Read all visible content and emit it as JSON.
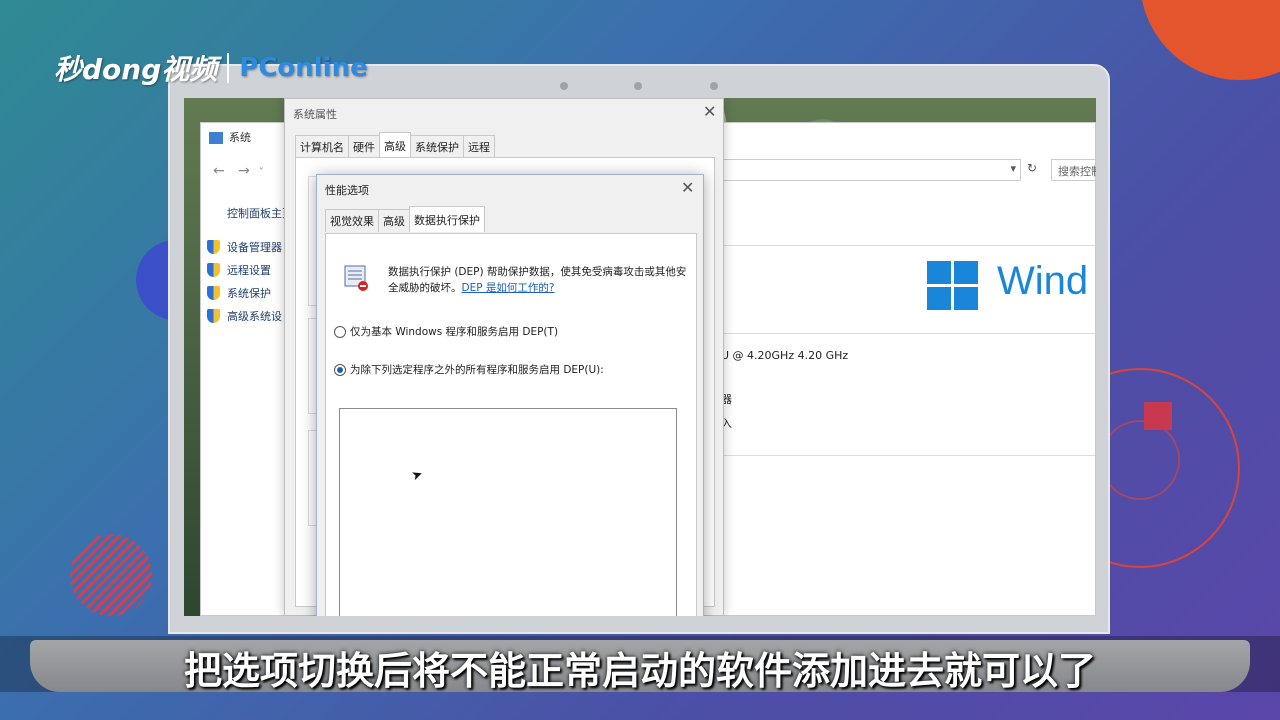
{
  "brand": {
    "name": "秒dong视频",
    "partner": "PConline"
  },
  "subtitle": "把选项切换后将不能正常启动的软件添加进去就可以了",
  "system_window": {
    "title": "系统",
    "search_placeholder": "搜索控制面",
    "side_home": "控制面板主页",
    "side_items": [
      "设备管理器",
      "远程设置",
      "系统保护",
      "高级系统设"
    ],
    "windows_text": "Wind",
    "cpu_text": "U @ 4.20GHz   4.20 GHz",
    "misc1": "器",
    "misc2": "入"
  },
  "system_properties": {
    "title": "系统属性",
    "tabs": [
      "计算机名",
      "硬件",
      "高级",
      "系统保护",
      "远程"
    ],
    "active_tab": "高级"
  },
  "performance_options": {
    "title": "性能选项",
    "tabs": [
      "视觉效果",
      "高级",
      "数据执行保护"
    ],
    "active_tab": "数据执行保护",
    "description": "数据执行保护 (DEP) 帮助保护数据，使其免受病毒攻击或其他安全威胁的破坏。",
    "help_link": "DEP 是如何工作的?",
    "option_basic": "仅为基本 Windows 程序和服务启用 DEP(T)",
    "option_all": "为除下列选定程序之外的所有程序和服务启用 DEP(U):",
    "selected_option": "option_all"
  },
  "colors": {
    "accent": "#1a86d9",
    "link": "#1a5fbf",
    "deco_orange": "#e4552e"
  }
}
